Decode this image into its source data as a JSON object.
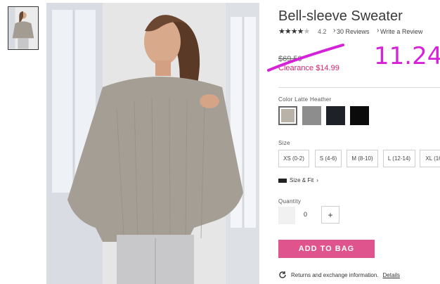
{
  "product": {
    "title": "Bell-sleeve Sweater",
    "rating_stars": 4.2,
    "rating_value": "4.2",
    "reviews_link": "30 Reviews",
    "write_review_link": "Write a Review",
    "original_price": "$69.50",
    "clearance_price": "Clearance $14.99",
    "handwritten_annotation": "11.24"
  },
  "color": {
    "label": "Color Latte Heather",
    "swatches": [
      {
        "name": "Latte Heather",
        "hex": "#b9b2a9",
        "selected": true
      },
      {
        "name": "Heather Gray",
        "hex": "#8d8d8d",
        "selected": false
      },
      {
        "name": "Navy",
        "hex": "#1e2228",
        "selected": false
      },
      {
        "name": "Black",
        "hex": "#0b0b0b",
        "selected": false
      }
    ]
  },
  "size": {
    "label": "Size",
    "options": [
      "XS (0-2)",
      "S (4-6)",
      "M (8-10)",
      "L (12-14)",
      "XL (16"
    ],
    "size_fit_link": "Size & Fit"
  },
  "quantity": {
    "label": "Quantity",
    "value": "0",
    "plus": "+"
  },
  "add_to_bag": "ADD TO BAG",
  "returns": {
    "text": "Returns and exchange information.",
    "link": "Details"
  },
  "colors": {
    "accent_pink": "#e0548e",
    "clearance_red": "#d6246e",
    "annotation_magenta": "#d522d8"
  }
}
